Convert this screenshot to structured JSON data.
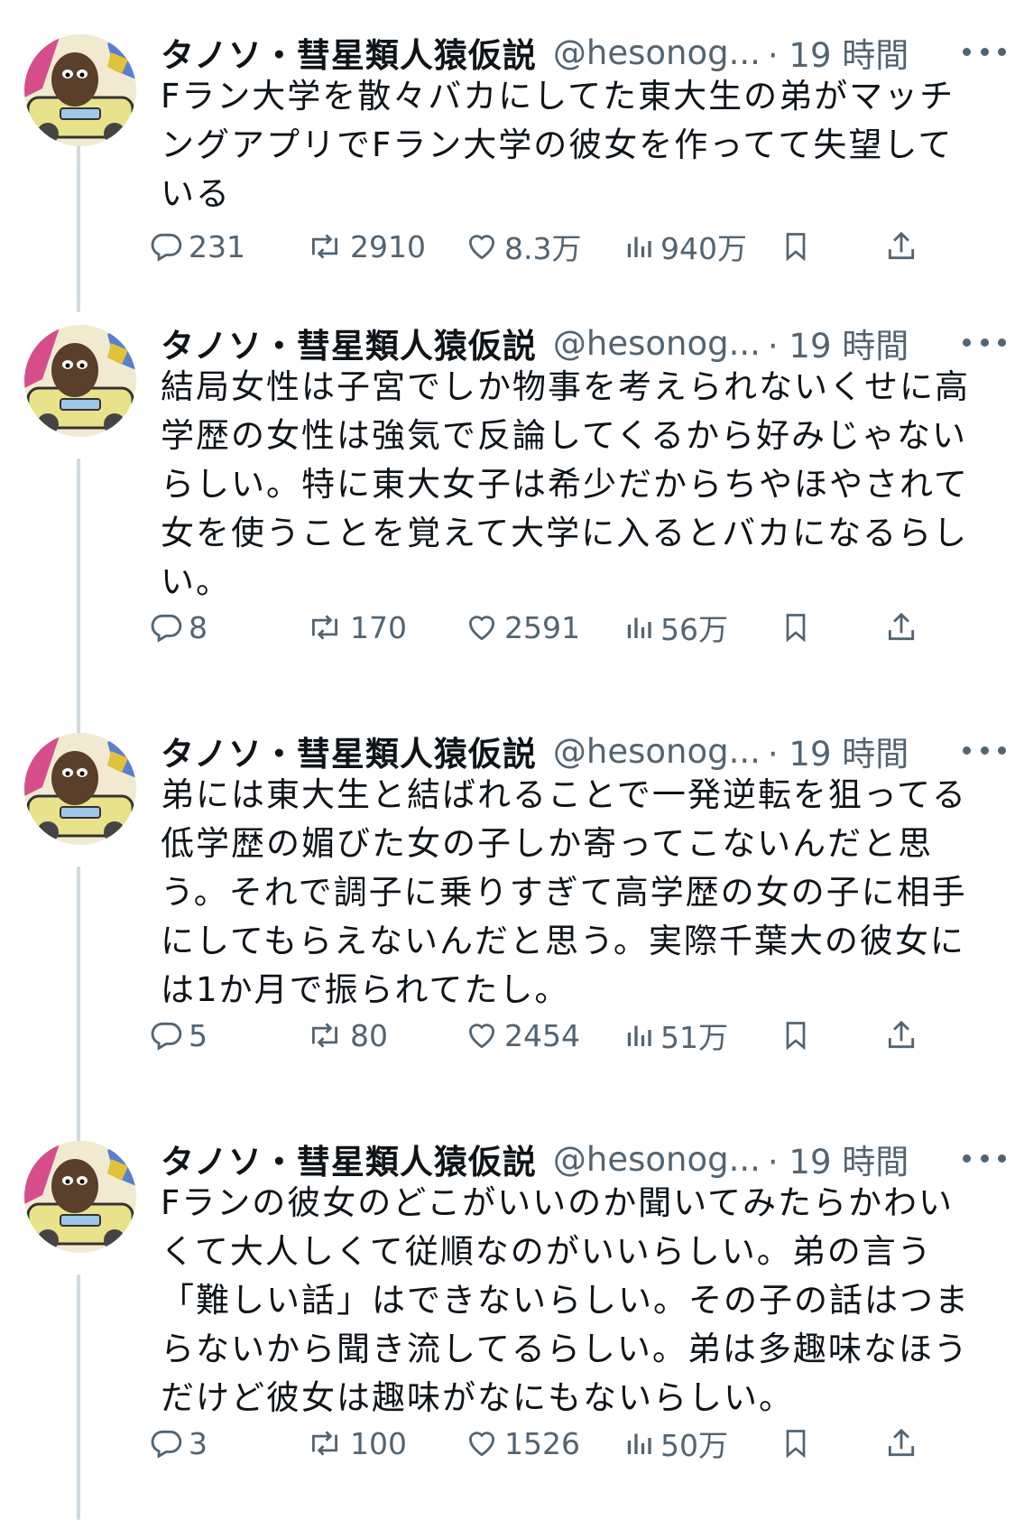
{
  "tweets": [
    {
      "display_name": "タノソ・彗星類人猿仮説",
      "handle": "@hesonog...",
      "time": "· 19 時間",
      "text": "Fラン大学を散々バカにしてた東大生の弟がマッチングアプリでFラン大学の彼女を作ってて失望している",
      "replies": "231",
      "reposts": "2910",
      "likes": "8.3万",
      "views": "940万"
    },
    {
      "display_name": "タノソ・彗星類人猿仮説",
      "handle": "@hesonog...",
      "time": "· 19 時間",
      "text": "結局女性は子宮でしか物事を考えられないくせに高学歴の女性は強気で反論してくるから好みじゃないらしい。特に東大女子は希少だからちやほやされて女を使うことを覚えて大学に入るとバカになるらしい。",
      "replies": "8",
      "reposts": "170",
      "likes": "2591",
      "views": "56万"
    },
    {
      "display_name": "タノソ・彗星類人猿仮説",
      "handle": "@hesonog...",
      "time": "· 19 時間",
      "text": "弟には東大生と結ばれることで一発逆転を狙ってる低学歴の媚びた女の子しか寄ってこないんだと思う。それで調子に乗りすぎて高学歴の女の子に相手にしてもらえないんだと思う。実際千葉大の彼女には1か月で振られてたし。",
      "replies": "5",
      "reposts": "80",
      "likes": "2454",
      "views": "51万"
    },
    {
      "display_name": "タノソ・彗星類人猿仮説",
      "handle": "@hesonog...",
      "time": "· 19 時間",
      "text": "Fランの彼女のどこがいいのか聞いてみたらかわいくて大人しくて従順なのがいいらしい。弟の言う「難しい話」はできないらしい。その子の話はつまらないから聞き流してるらしい。弟は多趣味なほうだけど彼女は趣味がなにもないらしい。",
      "replies": "3",
      "reposts": "100",
      "likes": "1526",
      "views": "50万"
    }
  ]
}
